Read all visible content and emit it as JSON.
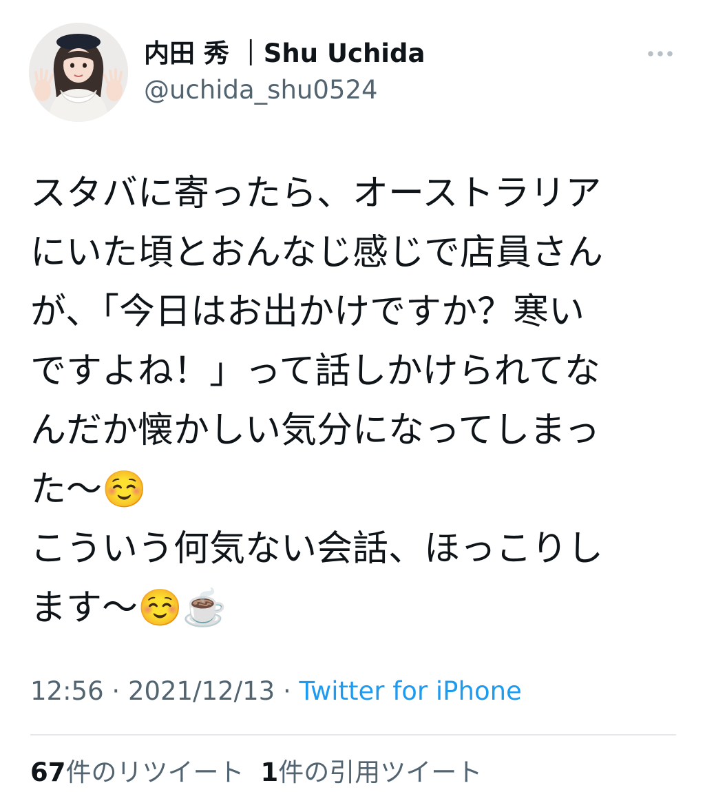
{
  "tweet": {
    "author": {
      "display_name": "内田 秀 ｜Shu Uchida",
      "handle": "@uchida_shu0524",
      "avatar_icon": "profile-photo-icon"
    },
    "more_icon": "more-dots-icon",
    "text": "スタバに寄ったら、オーストラリア\nにいた頃とおんなじ感じで店員さん\nが、「今日はお出かけですか？寒い\nですよね！」って話しかけられてな\nんだか懐かしい気分になってしまっ\nた〜☺️\nこういう何気ない会話、ほっこりし\nます〜☺️☕️",
    "time": "12:56",
    "separator": "·",
    "date": "2021/12/13",
    "source": "Twitter for iPhone",
    "stats": {
      "retweets_count": "67",
      "retweets_label": "件のリツイート",
      "quotes_count": "1",
      "quotes_label": "件の引用ツイート"
    }
  },
  "colors": {
    "text_primary": "#0f1419",
    "text_secondary": "#536471",
    "link": "#1d9bf0",
    "divider": "#e6e9eb"
  }
}
